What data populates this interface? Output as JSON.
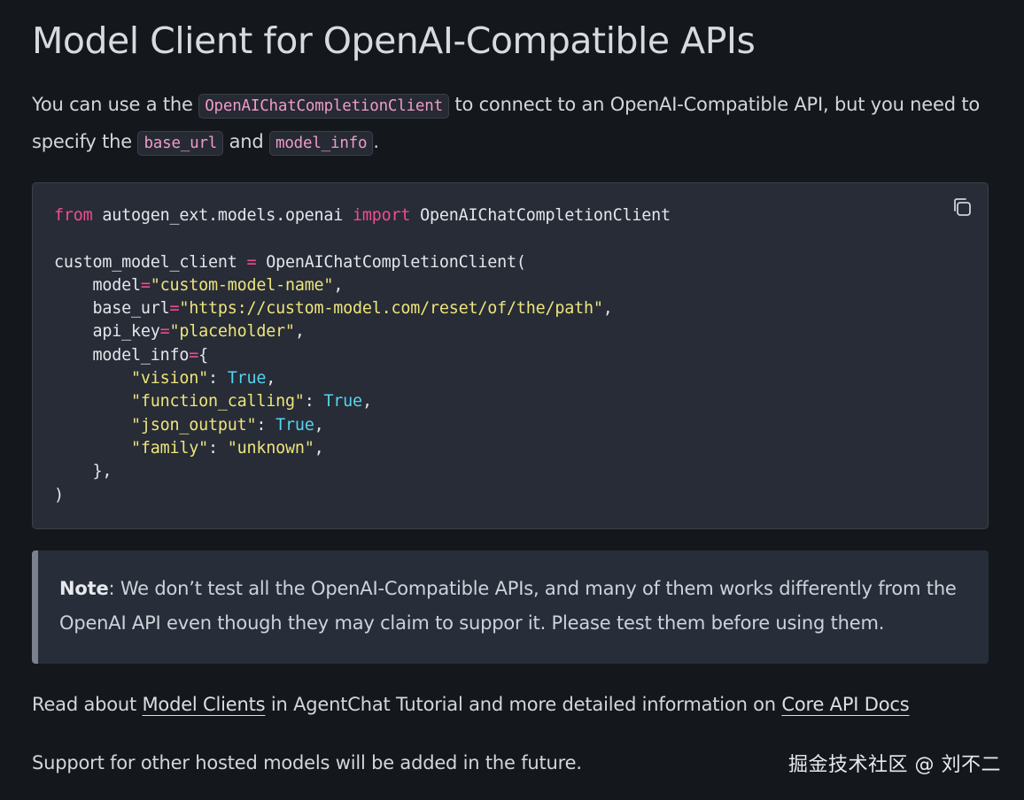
{
  "title": "Model Client for OpenAI-Compatible APIs",
  "intro": {
    "t1": "You can use a the ",
    "code1": "OpenAIChatCompletionClient",
    "t2": " to connect to an OpenAI-Compatible API, but you need to specify the ",
    "code2": "base_url",
    "t3": " and ",
    "code3": "model_info",
    "t4": "."
  },
  "code": {
    "copy_icon": "copy-icon",
    "l1_kw1": "from",
    "l1_mod": " autogen_ext.models.openai ",
    "l1_kw2": "import",
    "l1_name": " OpenAIChatCompletionClient",
    "l3_a": "custom_model_client ",
    "l3_op": "=",
    "l3_b": " OpenAIChatCompletionClient(",
    "l4_key": "    model",
    "l4_op": "=",
    "l4_val": "\"custom-model-name\"",
    "l4_end": ",",
    "l5_key": "    base_url",
    "l5_op": "=",
    "l5_val": "\"https://custom-model.com/reset/of/the/path\"",
    "l5_end": ",",
    "l6_key": "    api_key",
    "l6_op": "=",
    "l6_val": "\"placeholder\"",
    "l6_end": ",",
    "l7_key": "    model_info",
    "l7_op": "=",
    "l7_end": "{",
    "l8_ind": "        ",
    "l8_key": "\"vision\"",
    "l8_sep": ": ",
    "l8_val": "True",
    "l8_end": ",",
    "l9_ind": "        ",
    "l9_key": "\"function_calling\"",
    "l9_sep": ": ",
    "l9_val": "True",
    "l9_end": ",",
    "l10_ind": "        ",
    "l10_key": "\"json_output\"",
    "l10_sep": ": ",
    "l10_val": "True",
    "l10_end": ",",
    "l11_ind": "        ",
    "l11_key": "\"family\"",
    "l11_sep": ": ",
    "l11_val": "\"unknown\"",
    "l11_end": ",",
    "l12": "    },",
    "l13": ")"
  },
  "note": {
    "label": "Note",
    "text": ": We don’t test all the OpenAI-Compatible APIs, and many of them works differently from the OpenAI API even though they may claim to suppor it. Please test them before using them."
  },
  "read": {
    "t1": "Read about ",
    "link1": "Model Clients",
    "t2": " in AgentChat Tutorial and more detailed information on ",
    "link2": "Core API Docs"
  },
  "support": "Support for other hosted models will be added in the future.",
  "watermark": "掘金技术社区 @ 刘不二",
  "colors": {
    "background": "#14171c",
    "code_bg": "#272c37",
    "keyword": "#f14d8b",
    "string": "#ede47a",
    "boolean": "#56d3ee",
    "inline_code": "#ee9bcb"
  }
}
